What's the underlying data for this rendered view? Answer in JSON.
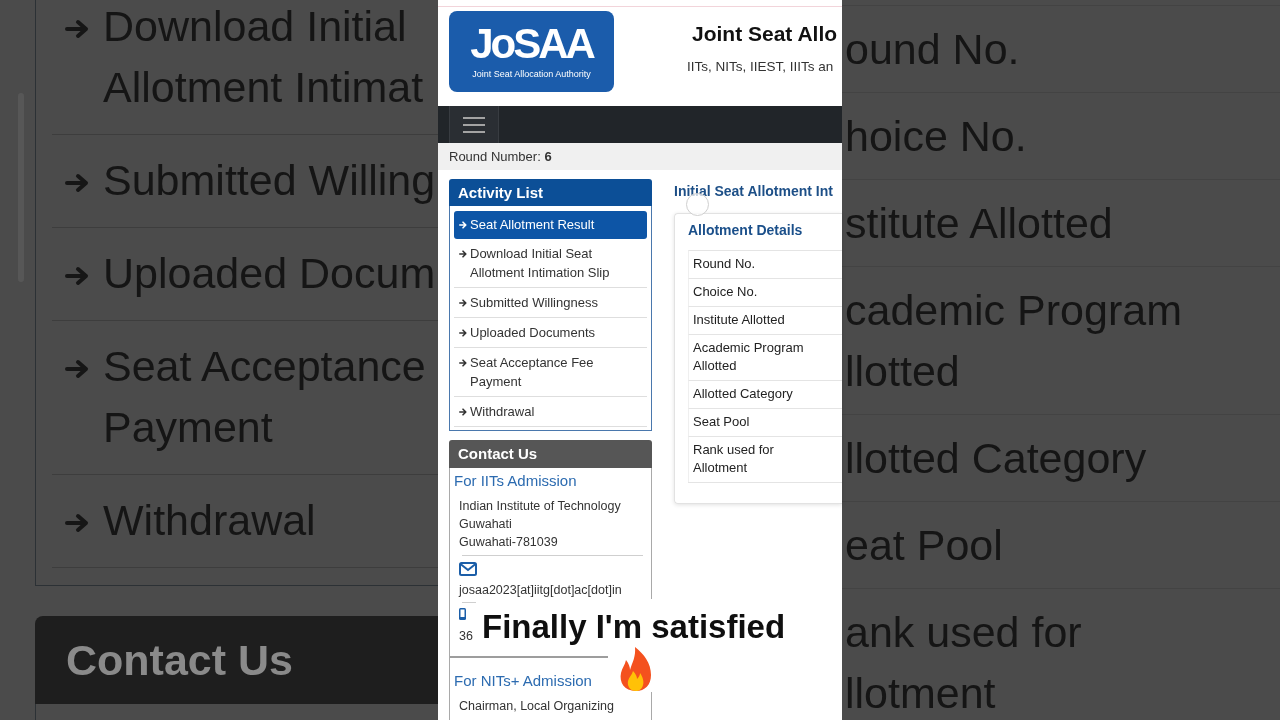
{
  "backdrop_left": {
    "items": [
      {
        "lines": [
          "Download Initial",
          "Allotment Intimat"
        ]
      },
      {
        "lines": [
          "Submitted Willing"
        ]
      },
      {
        "lines": [
          "Uploaded Docum"
        ]
      },
      {
        "lines": [
          "Seat Acceptance",
          "Payment"
        ]
      },
      {
        "lines": [
          "Withdrawal"
        ]
      }
    ],
    "contact_title": "Contact Us"
  },
  "header": {
    "logo_wordmark": "JoSAA",
    "logo_tagline": "Joint Seat Allocation Authority",
    "title": "Joint Seat Allo",
    "subtitle": "IITs, NITs, IIEST, IIITs an"
  },
  "round_info": "Round Number: **6**",
  "activity_list": {
    "title": "Activity List",
    "items": [
      {
        "lines": [
          "Seat Allotment Result"
        ],
        "selected": true
      },
      {
        "lines": [
          "Download Initial Seat",
          "Allotment Intimation Slip"
        ],
        "selected": false
      },
      {
        "lines": [
          "Submitted Willingness"
        ],
        "selected": false
      },
      {
        "lines": [
          "Uploaded Documents"
        ],
        "selected": false
      },
      {
        "lines": [
          "Seat Acceptance Fee",
          "Payment"
        ],
        "selected": false
      },
      {
        "lines": [
          "Withdrawal"
        ],
        "selected": false
      }
    ]
  },
  "contact": {
    "title": "Contact Us",
    "sections": [
      {
        "heading": "For IITs Admission",
        "address": [
          "Indian Institute of Technology",
          "Guwahati",
          "Guwahati-781039"
        ],
        "email": "josaa2023[at]iitg[dot]ac[dot]in",
        "phone": "36"
      },
      {
        "heading": "For NITs+ Admission",
        "address": [
          "Chairman, Local Organizing"
        ]
      }
    ]
  },
  "allotment": {
    "heading": "Initial Seat Allotment Int",
    "card_title": "Allotment Details",
    "rows": [
      {
        "lines": [
          "Round No."
        ]
      },
      {
        "lines": [
          "Choice No."
        ]
      },
      {
        "lines": [
          "Institute Allotted"
        ]
      },
      {
        "lines": [
          "Academic Program",
          "Allotted"
        ]
      },
      {
        "lines": [
          "Allotted Category"
        ]
      },
      {
        "lines": [
          "Seat Pool"
        ]
      },
      {
        "lines": [
          "Rank used for",
          "Allotment"
        ]
      }
    ]
  },
  "backdrop_right": {
    "rows": [
      {
        "lines": [
          "ound No."
        ]
      },
      {
        "lines": [
          "hoice No."
        ]
      },
      {
        "lines": [
          "stitute Allotted"
        ]
      },
      {
        "lines": [
          "cademic Program",
          "llotted"
        ]
      },
      {
        "lines": [
          "llotted Category"
        ]
      },
      {
        "lines": [
          "eat Pool"
        ]
      },
      {
        "lines": [
          "ank used for",
          "llotment"
        ]
      }
    ]
  },
  "caption": {
    "text": "Finally I'm satisfied"
  }
}
